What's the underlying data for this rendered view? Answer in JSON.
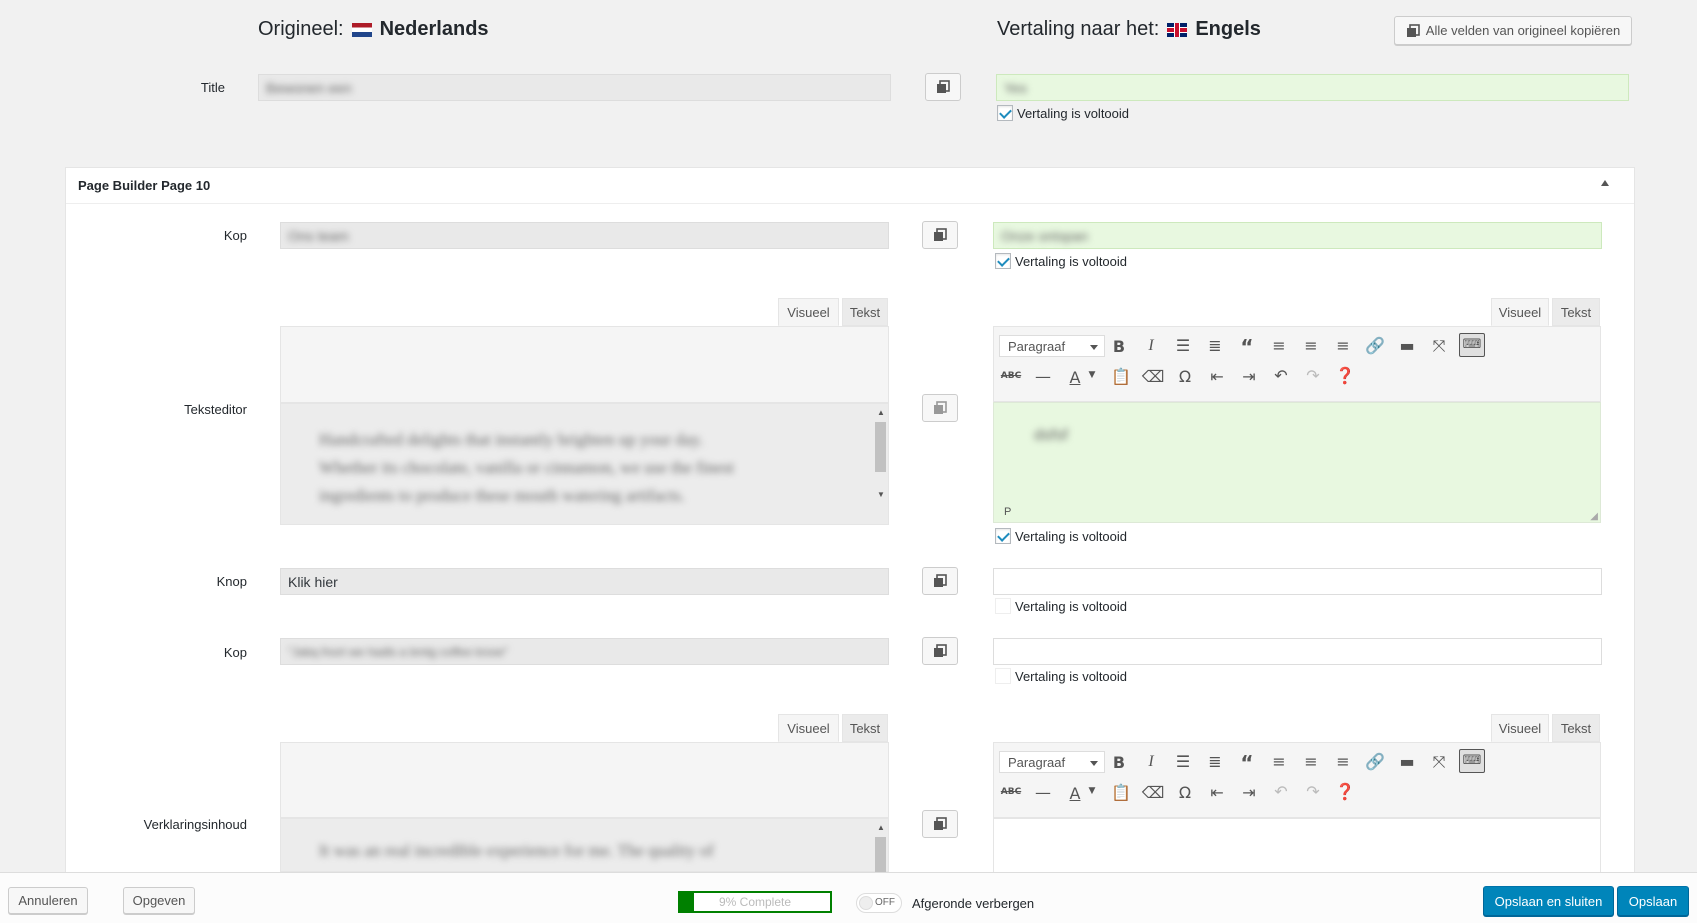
{
  "header": {
    "original_label": "Origineel:",
    "original_lang": "Nederlands",
    "translation_label": "Vertaling naar het:",
    "translation_lang": "Engels",
    "copy_all_label": "Alle velden van origineel kopiëren"
  },
  "title_row": {
    "label": "Title",
    "original_value": "Bewonen een",
    "translated_value": "Yes",
    "complete_label": "Vertaling is voltooid",
    "complete": true
  },
  "panel": {
    "title": "Page Builder Page 10",
    "collapse_icon": "triangle-up-icon"
  },
  "rows": {
    "kop1": {
      "label": "Kop",
      "original_value": "Ons team",
      "translated_value": "Onze ontspan",
      "complete_label": "Vertaling is voltooid",
      "complete": true
    },
    "teksteditor": {
      "label": "Teksteditor",
      "tab_visual": "Visueel",
      "tab_text": "Tekst",
      "original_lines": [
        "Handcrafted delights that instantly brighten up your day.",
        "Whether its chocolate, vanilla or cinnamon, we use the finest",
        "ingredients to produce these mouth watering artifacts."
      ],
      "translated_value": "dsfsf",
      "path_label": "P",
      "complete_label": "Vertaling is voltooid",
      "complete": true,
      "format_select": "Paragraaf"
    },
    "knop": {
      "label": "Knop",
      "original_value": "Klik hier",
      "translated_value": "",
      "complete_label": "Vertaling is voltooid",
      "complete": false
    },
    "kop2": {
      "label": "Kop",
      "original_value": "\"Jabq fnort we hadls a bmtg coffee know\"",
      "translated_value": "",
      "complete_label": "Vertaling is voltooid",
      "complete": false
    },
    "verklaring": {
      "label": "Verklaringsinhoud",
      "tab_visual": "Visueel",
      "tab_text": "Tekst",
      "original_line": "It was an real incredible experience for me. The quality of",
      "format_select": "Paragraaf"
    }
  },
  "footer": {
    "cancel_label": "Annuleren",
    "resign_label": "Opgeven",
    "progress_text": "9% Complete",
    "progress_value": 0.09,
    "toggle_state": "OFF",
    "hide_completed_label": "Afgeronde verbergen",
    "save_close_label": "Opslaan en sluiten",
    "save_label": "Opslaan"
  },
  "colors": {
    "primary": "#0085ba",
    "complete_green": "#e8f8e0",
    "progress_green": "#008000"
  }
}
